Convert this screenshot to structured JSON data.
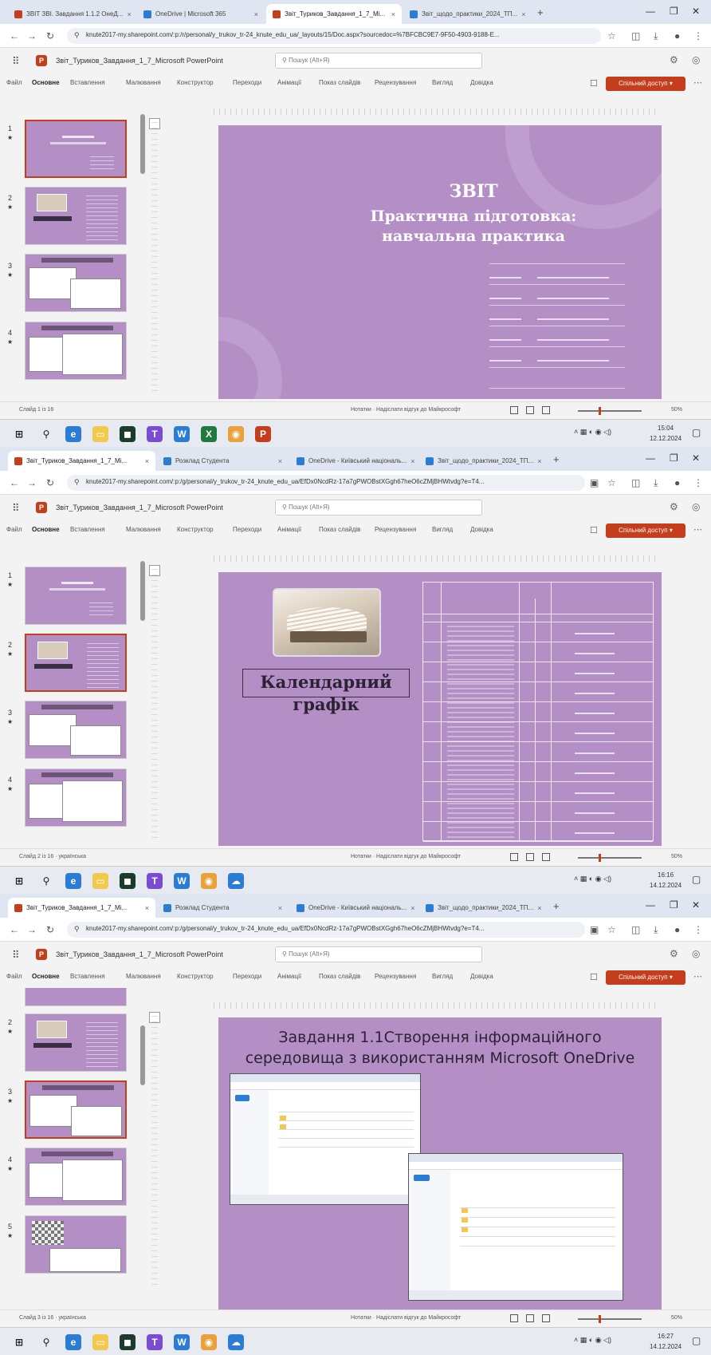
{
  "screens": [
    {
      "tabs": [
        {
          "label": "ЗВІТ ЗВІ. Завдання 1.1.2 ОнеД...",
          "fav": "#c43e1c"
        },
        {
          "label": "OneDrive | Microsoft 365",
          "fav": "#2b7cd3"
        },
        {
          "label": "Звіт_Туриков_Завдання_1_7_Mi...",
          "fav": "#c43e1c"
        },
        {
          "label": "Звіт_щодо_практики_2024_ТП...",
          "fav": "#2b7cd3"
        }
      ],
      "active_tab": 2,
      "url": "knute2017-my.sharepoint.com/:p:/r/personal/y_trukov_tr-24_knute_edu_ua/_layouts/15/Doc.aspx?sourcedoc=%7BFCBC9E7-9F50-4903-9188-E...",
      "search_placeholder": "Пошук (Alt+Я)",
      "thumb_numbers": [
        "1",
        "2",
        "3",
        "4"
      ],
      "status_left": "Слайд 1 із 16",
      "clock_time": "15:04",
      "clock_date": "12.12.2024"
    },
    {
      "tabs": [
        {
          "label": "Звіт_Туриков_Завдання_1_7_Mi...",
          "fav": "#c43e1c"
        },
        {
          "label": "Розклад Студента",
          "fav": "#2b7cd3"
        },
        {
          "label": "OneDrive - Київський національ...",
          "fav": "#2b7cd3"
        },
        {
          "label": "Звіт_щодо_практики_2024_ТП...",
          "fav": "#2b7cd3"
        }
      ],
      "active_tab": 0,
      "url": "knute2017-my.sharepoint.com/:p:/g/personal/y_trukov_tr-24_knute_edu_ua/EfDx0NcdRz-17a7gPWOBstXGgh67heO6cZMjBHWtvdg?e=T4...",
      "search_placeholder": "Пошук (Alt+Я)",
      "thumb_numbers": [
        "1",
        "2",
        "3",
        "4"
      ],
      "status_left": "Слайд 2 із 16 · українська",
      "clock_time": "16:16",
      "clock_date": "14.12.2024"
    },
    {
      "tabs": [
        {
          "label": "Звіт_Туриков_Завдання_1_7_Mi...",
          "fav": "#c43e1c"
        },
        {
          "label": "Розклад Студента",
          "fav": "#2b7cd3"
        },
        {
          "label": "OneDrive - Київський національ...",
          "fav": "#2b7cd3"
        },
        {
          "label": "Звіт_щодо_практики_2024_ТП...",
          "fav": "#2b7cd3"
        }
      ],
      "active_tab": 0,
      "url": "knute2017-my.sharepoint.com/:p:/g/personal/y_trukov_tr-24_knute_edu_ua/EfDx0NcdRz-17a7gPWOBstXGgh67heO6cZMjBHWtvdg?e=T4...",
      "search_placeholder": "Пошук (Alt+Я)",
      "thumb_numbers": [
        "2",
        "3",
        "4",
        "5"
      ],
      "status_left": "Слайд 3 із 16 · українська",
      "clock_time": "16:27",
      "clock_date": "14.12.2024"
    }
  ],
  "doc_title": "Звіт_Туриков_Завдання_1_7_Microsoft PowerPoint",
  "ribbon_tabs": [
    "Файл",
    "Основне",
    "Вставлення",
    "Малювання",
    "Конструктор",
    "Переходи",
    "Анімації",
    "Показ слайдів",
    "Рецензування",
    "Вигляд",
    "Довідка"
  ],
  "share_label": "Спільний доступ",
  "status_center": "Нотатки · Надіслати відгук до Майкрософт",
  "zoom": "50%",
  "slide1": {
    "title": "ЗВІТ",
    "subtitle": "Практична підготовка: навчальна практика"
  },
  "slide2": {
    "title": "Календарний графік"
  },
  "slide3": {
    "title": "Завдання 1.1Створення інформаційного середовища з використанням Microsoft OneDrive"
  },
  "colors": {
    "slide_bg": "#b48fc6",
    "accent": "#c43e1c",
    "title_text": "#ffffff",
    "dark_text": "#2b2333"
  },
  "icons": [
    "back-icon",
    "forward-icon",
    "reload-icon",
    "star-icon",
    "download-icon",
    "profile-icon",
    "settings-icon",
    "search-icon",
    "waffle-icon",
    "windows-icon"
  ]
}
